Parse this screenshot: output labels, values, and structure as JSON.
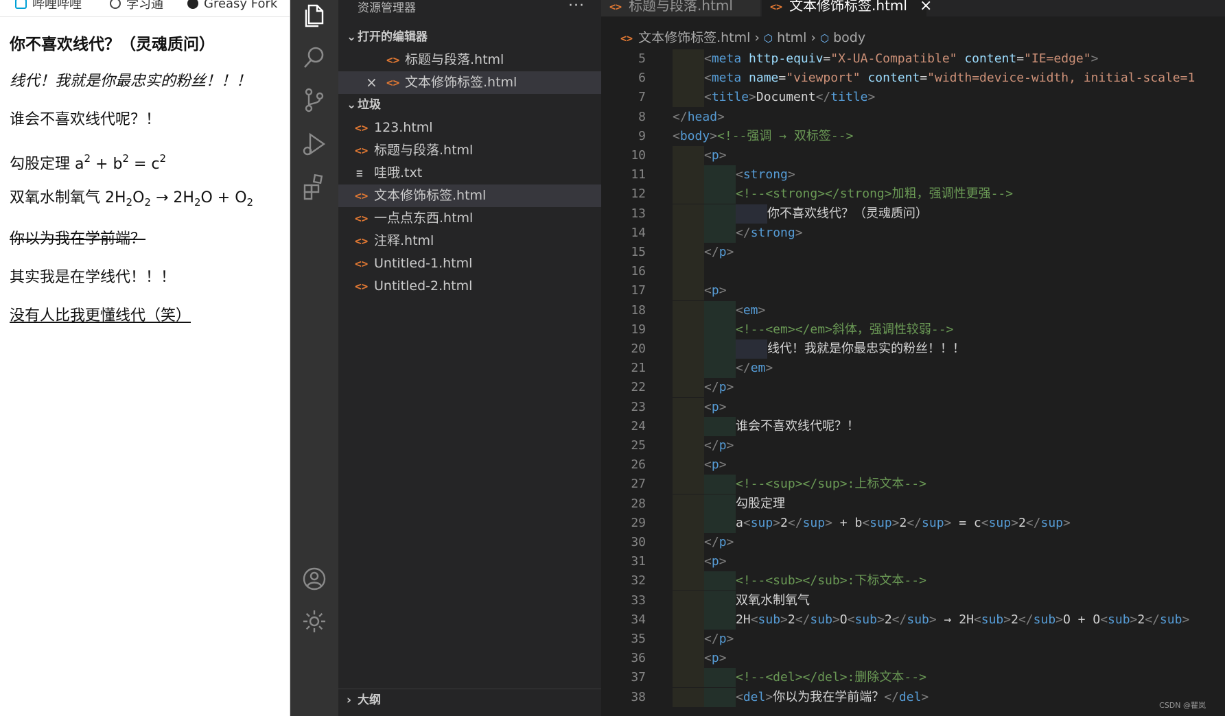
{
  "browser": {
    "bookmarks": [
      "哔哩哔哩",
      "学习通",
      "Greasy Fork"
    ],
    "lines": {
      "l1": "你不喜欢线代？（灵魂质问）",
      "l2": "线代！我就是你最忠实的粉丝！！！",
      "l3": "谁会不喜欢线代呢？！",
      "l4_prefix": "勾股定理 a",
      "l4_sup1": "2",
      "l4_mid1": " + b",
      "l4_sup2": "2",
      "l4_mid2": " = c",
      "l4_sup3": "2",
      "l5_prefix": "双氧水制氧气 2H",
      "l5_sub1": "2",
      "l5_mid1": "O",
      "l5_sub2": "2",
      "l5_mid2": " → 2H",
      "l5_sub3": "2",
      "l5_mid3": "O + O",
      "l5_sub4": "2",
      "l6": "你以为我在学前端？",
      "l7": "其实我是在学线代！！！",
      "l8": "没有人比我更懂线代（笑）"
    }
  },
  "sidebar": {
    "title": "资源管理器",
    "more": "···",
    "open_editors_label": "打开的编辑器",
    "open_editors": [
      "标题与段落.html",
      "文本修饰标签.html"
    ],
    "folder_label": "垃圾",
    "files": [
      "123.html",
      "标题与段落.html",
      "哇哦.txt",
      "文本修饰标签.html",
      "一点点东西.html",
      "注释.html",
      "Untitled-1.html",
      "Untitled-2.html"
    ],
    "outline_label": "大纲"
  },
  "editor": {
    "tabs": [
      "标题与段落.html",
      "文本修饰标签.html"
    ],
    "close_glyph": "×",
    "breadcrumb": [
      "文本修饰标签.html",
      "html",
      "body"
    ]
  },
  "code_lines": [
    {
      "n": "5",
      "i": 1,
      "s": [
        [
          "tg",
          "<"
        ],
        [
          "tn",
          "meta"
        ],
        [
          "cn",
          " "
        ],
        [
          "at",
          "http-equiv"
        ],
        [
          "cn",
          "="
        ],
        [
          "av",
          "\"X-UA-Compatible\""
        ],
        [
          "cn",
          " "
        ],
        [
          "at",
          "content"
        ],
        [
          "cn",
          "="
        ],
        [
          "av",
          "\"IE=edge\""
        ],
        [
          "tg",
          ">"
        ]
      ]
    },
    {
      "n": "6",
      "i": 1,
      "s": [
        [
          "tg",
          "<"
        ],
        [
          "tn",
          "meta"
        ],
        [
          "cn",
          " "
        ],
        [
          "at",
          "name"
        ],
        [
          "cn",
          "="
        ],
        [
          "av",
          "\"viewport\""
        ],
        [
          "cn",
          " "
        ],
        [
          "at",
          "content"
        ],
        [
          "cn",
          "="
        ],
        [
          "av",
          "\"width=device-width, initial-scale=1"
        ]
      ]
    },
    {
      "n": "7",
      "i": 1,
      "s": [
        [
          "tg",
          "<"
        ],
        [
          "tn",
          "title"
        ],
        [
          "tg",
          ">"
        ],
        [
          "cn",
          "Document"
        ],
        [
          "tg",
          "</"
        ],
        [
          "tn",
          "title"
        ],
        [
          "tg",
          ">"
        ]
      ]
    },
    {
      "n": "8",
      "i": 0,
      "s": [
        [
          "tg",
          "</"
        ],
        [
          "tn",
          "head"
        ],
        [
          "tg",
          ">"
        ]
      ]
    },
    {
      "n": "9",
      "i": 0,
      "s": [
        [
          "tg",
          "<"
        ],
        [
          "tn",
          "body"
        ],
        [
          "tg",
          ">"
        ],
        [
          "cm",
          "<!--强调 → 双标签-->"
        ]
      ]
    },
    {
      "n": "10",
      "i": 1,
      "s": [
        [
          "tg",
          "<"
        ],
        [
          "tn",
          "p"
        ],
        [
          "tg",
          ">"
        ]
      ]
    },
    {
      "n": "11",
      "i": 2,
      "s": [
        [
          "tg",
          "<"
        ],
        [
          "tn",
          "strong"
        ],
        [
          "tg",
          ">"
        ]
      ]
    },
    {
      "n": "12",
      "i": 2,
      "s": [
        [
          "cm",
          "<!--<strong></strong>加粗，强调性更强-->"
        ]
      ]
    },
    {
      "n": "13",
      "i": 3,
      "s": [
        [
          "cn",
          "你不喜欢线代？（灵魂质问）"
        ]
      ]
    },
    {
      "n": "14",
      "i": 2,
      "s": [
        [
          "tg",
          "</"
        ],
        [
          "tn",
          "strong"
        ],
        [
          "tg",
          ">"
        ]
      ]
    },
    {
      "n": "15",
      "i": 1,
      "s": [
        [
          "tg",
          "</"
        ],
        [
          "tn",
          "p"
        ],
        [
          "tg",
          ">"
        ]
      ]
    },
    {
      "n": "16",
      "i": 0,
      "s": []
    },
    {
      "n": "17",
      "i": 1,
      "s": [
        [
          "tg",
          "<"
        ],
        [
          "tn",
          "p"
        ],
        [
          "tg",
          ">"
        ]
      ]
    },
    {
      "n": "18",
      "i": 2,
      "s": [
        [
          "tg",
          "<"
        ],
        [
          "tn",
          "em"
        ],
        [
          "tg",
          ">"
        ]
      ]
    },
    {
      "n": "19",
      "i": 2,
      "s": [
        [
          "cm",
          "<!--<em></em>斜体，强调性较弱-->"
        ]
      ]
    },
    {
      "n": "20",
      "i": 3,
      "s": [
        [
          "cn",
          "线代！我就是你最忠实的粉丝！！！"
        ]
      ]
    },
    {
      "n": "21",
      "i": 2,
      "s": [
        [
          "tg",
          "</"
        ],
        [
          "tn",
          "em"
        ],
        [
          "tg",
          ">"
        ]
      ]
    },
    {
      "n": "22",
      "i": 1,
      "s": [
        [
          "tg",
          "</"
        ],
        [
          "tn",
          "p"
        ],
        [
          "tg",
          ">"
        ]
      ]
    },
    {
      "n": "23",
      "i": 1,
      "s": [
        [
          "tg",
          "<"
        ],
        [
          "tn",
          "p"
        ],
        [
          "tg",
          ">"
        ]
      ]
    },
    {
      "n": "24",
      "i": 2,
      "s": [
        [
          "cn",
          "谁会不喜欢线代呢？！"
        ]
      ]
    },
    {
      "n": "25",
      "i": 1,
      "s": [
        [
          "tg",
          "</"
        ],
        [
          "tn",
          "p"
        ],
        [
          "tg",
          ">"
        ]
      ]
    },
    {
      "n": "26",
      "i": 1,
      "s": [
        [
          "tg",
          "<"
        ],
        [
          "tn",
          "p"
        ],
        [
          "tg",
          ">"
        ]
      ]
    },
    {
      "n": "27",
      "i": 2,
      "s": [
        [
          "cm",
          "<!--<sup></sup>:上标文本-->"
        ]
      ]
    },
    {
      "n": "28",
      "i": 2,
      "s": [
        [
          "cn",
          "勾股定理"
        ]
      ]
    },
    {
      "n": "29",
      "i": 2,
      "s": [
        [
          "cn",
          "a"
        ],
        [
          "tg",
          "<"
        ],
        [
          "tn",
          "sup"
        ],
        [
          "tg",
          ">"
        ],
        [
          "cn",
          "2"
        ],
        [
          "tg",
          "</"
        ],
        [
          "tn",
          "sup"
        ],
        [
          "tg",
          ">"
        ],
        [
          "cn",
          " + b"
        ],
        [
          "tg",
          "<"
        ],
        [
          "tn",
          "sup"
        ],
        [
          "tg",
          ">"
        ],
        [
          "cn",
          "2"
        ],
        [
          "tg",
          "</"
        ],
        [
          "tn",
          "sup"
        ],
        [
          "tg",
          ">"
        ],
        [
          "cn",
          " = c"
        ],
        [
          "tg",
          "<"
        ],
        [
          "tn",
          "sup"
        ],
        [
          "tg",
          ">"
        ],
        [
          "cn",
          "2"
        ],
        [
          "tg",
          "</"
        ],
        [
          "tn",
          "sup"
        ],
        [
          "tg",
          ">"
        ]
      ]
    },
    {
      "n": "30",
      "i": 1,
      "s": [
        [
          "tg",
          "</"
        ],
        [
          "tn",
          "p"
        ],
        [
          "tg",
          ">"
        ]
      ]
    },
    {
      "n": "31",
      "i": 1,
      "s": [
        [
          "tg",
          "<"
        ],
        [
          "tn",
          "p"
        ],
        [
          "tg",
          ">"
        ]
      ]
    },
    {
      "n": "32",
      "i": 2,
      "s": [
        [
          "cm",
          "<!--<sub></sub>:下标文本-->"
        ]
      ]
    },
    {
      "n": "33",
      "i": 2,
      "s": [
        [
          "cn",
          "双氧水制氧气"
        ]
      ]
    },
    {
      "n": "34",
      "i": 2,
      "s": [
        [
          "cn",
          "2H"
        ],
        [
          "tg",
          "<"
        ],
        [
          "tn",
          "sub"
        ],
        [
          "tg",
          ">"
        ],
        [
          "cn",
          "2"
        ],
        [
          "tg",
          "</"
        ],
        [
          "tn",
          "sub"
        ],
        [
          "tg",
          ">"
        ],
        [
          "cn",
          "O"
        ],
        [
          "tg",
          "<"
        ],
        [
          "tn",
          "sub"
        ],
        [
          "tg",
          ">"
        ],
        [
          "cn",
          "2"
        ],
        [
          "tg",
          "</"
        ],
        [
          "tn",
          "sub"
        ],
        [
          "tg",
          ">"
        ],
        [
          "cn",
          " → 2H"
        ],
        [
          "tg",
          "<"
        ],
        [
          "tn",
          "sub"
        ],
        [
          "tg",
          ">"
        ],
        [
          "cn",
          "2"
        ],
        [
          "tg",
          "</"
        ],
        [
          "tn",
          "sub"
        ],
        [
          "tg",
          ">"
        ],
        [
          "cn",
          "O + O"
        ],
        [
          "tg",
          "<"
        ],
        [
          "tn",
          "sub"
        ],
        [
          "tg",
          ">"
        ],
        [
          "cn",
          "2"
        ],
        [
          "tg",
          "</"
        ],
        [
          "tn",
          "sub"
        ],
        [
          "tg",
          ">"
        ]
      ]
    },
    {
      "n": "35",
      "i": 1,
      "s": [
        [
          "tg",
          "</"
        ],
        [
          "tn",
          "p"
        ],
        [
          "tg",
          ">"
        ]
      ]
    },
    {
      "n": "36",
      "i": 1,
      "s": [
        [
          "tg",
          "<"
        ],
        [
          "tn",
          "p"
        ],
        [
          "tg",
          ">"
        ]
      ]
    },
    {
      "n": "37",
      "i": 2,
      "s": [
        [
          "cm",
          "<!--<del></del>:删除文本-->"
        ]
      ]
    },
    {
      "n": "38",
      "i": 2,
      "s": [
        [
          "tg",
          "<"
        ],
        [
          "tn",
          "del"
        ],
        [
          "tg",
          ">"
        ],
        [
          "cn",
          "你以为我在学前端？"
        ],
        [
          "tg",
          "</"
        ],
        [
          "tn",
          "del"
        ],
        [
          "tg",
          ">"
        ]
      ]
    }
  ],
  "watermark": "CSDN @瞿岚",
  "colors": {
    "accent_icon": "#e37933",
    "keyword": "#569cd6",
    "string": "#ce9178",
    "comment": "#6a9955"
  }
}
